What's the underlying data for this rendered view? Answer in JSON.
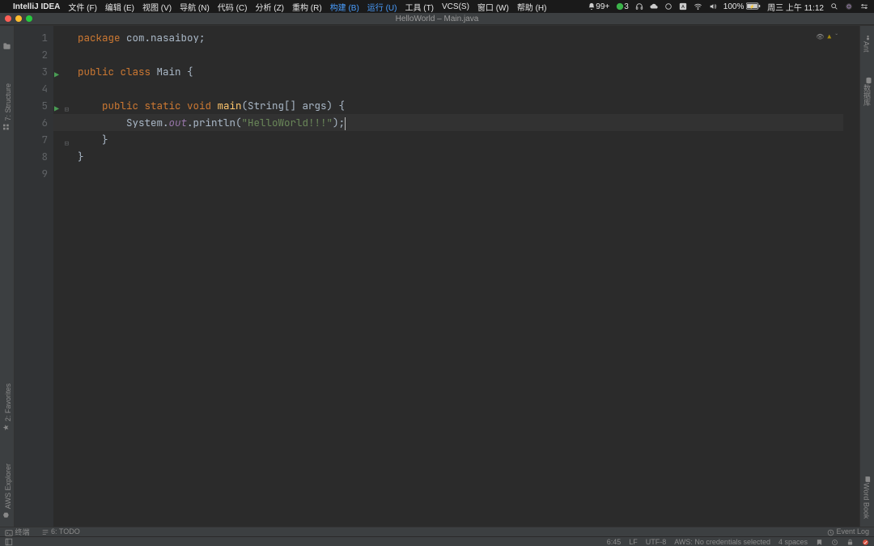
{
  "mac_menu": {
    "app_name": "IntelliJ IDEA",
    "items": [
      "文件 (F)",
      "编辑 (E)",
      "视图 (V)",
      "导航 (N)",
      "代码 (C)",
      "分析 (Z)",
      "重构 (R)",
      "构建 (B)",
      "运行 (U)",
      "工具 (T)",
      "VCS(S)",
      "窗口 (W)",
      "帮助 (H)"
    ],
    "highlight_indices": [
      7,
      8
    ],
    "right": {
      "notif": "99+",
      "wechat": "3",
      "battery": "100%",
      "clock": "周三 上午 11:12"
    }
  },
  "window": {
    "title": "HelloWorld – Main.java"
  },
  "left_tools": {
    "structure": "7: Structure",
    "favorites": "2: Favorites",
    "aws": "AWS Explorer"
  },
  "right_tools": {
    "ant": "Ant",
    "db": "数据库",
    "wordbook": "Word Book"
  },
  "editor": {
    "lines": [
      "1",
      "2",
      "3",
      "4",
      "5",
      "6",
      "7",
      "8",
      "9"
    ],
    "run_markers": [
      3,
      5
    ],
    "fold_markers": [
      5,
      7
    ],
    "code": {
      "l1_kw": "package",
      "l1_rest": " com.nasaiboy;",
      "l3_kw": "public class",
      "l3_cls": " Main ",
      "l3_brace": "{",
      "l5_kw": "public static void",
      "l5_fn": " main",
      "l5_sig": "(String[] args) {",
      "l6_pre": "        System.",
      "l6_field": "out",
      "l6_mid": ".println(",
      "l6_str": "\"HelloWorld!!!\"",
      "l6_post": ");",
      "l7": "    }",
      "l8": "}"
    }
  },
  "bottom_tools": {
    "terminal": "终端",
    "todo": "6: TODO",
    "event_log": "Event Log"
  },
  "status": {
    "pos": "6:45",
    "sep": "LF",
    "enc": "UTF-8",
    "aws": "AWS: No credentials selected",
    "indent": "4 spaces"
  }
}
